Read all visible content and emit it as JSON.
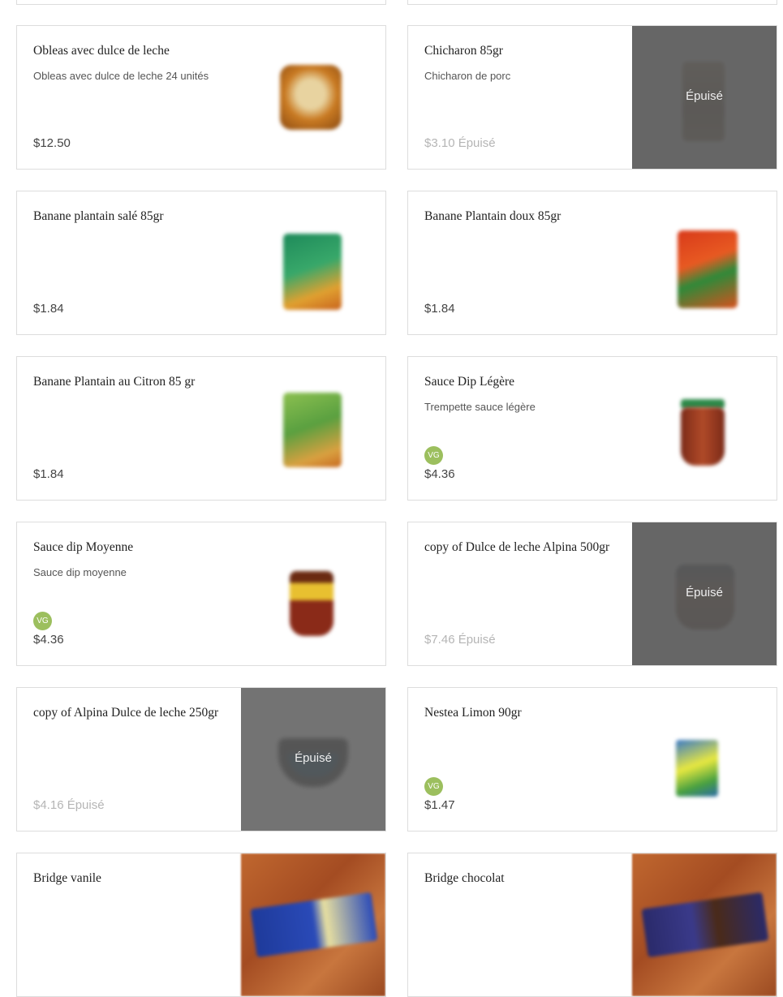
{
  "sold_out_label": "Épuisé",
  "vg_badge": "VG",
  "colors": {
    "border": "#dddddd",
    "overlay": "#5a5a5a",
    "vg_badge": "#9cbf5e",
    "sold_out_price": "#b5b5b5"
  },
  "products": [
    {
      "name": "Obleas avec dulce de leche",
      "description": "Obleas avec dulce de leche 24 unités",
      "price": "$12.50",
      "sold_out": false,
      "vegan": false,
      "image": "wafer-box-thumbnail"
    },
    {
      "name": "Chicharon 85gr",
      "description": "Chicharon de porc",
      "price": "$3.10 Épuisé",
      "sold_out": true,
      "vegan": false,
      "image": "chicharon-bag-thumbnail"
    },
    {
      "name": "Banane plantain salé 85gr",
      "description": "",
      "price": "$1.84",
      "sold_out": false,
      "vegan": false,
      "image": "green-chips-bag-thumbnail"
    },
    {
      "name": "Banane Plantain doux 85gr",
      "description": "",
      "price": "$1.84",
      "sold_out": false,
      "vegan": false,
      "image": "red-chips-bag-thumbnail"
    },
    {
      "name": "Banane Plantain au Citron 85 gr",
      "description": "",
      "price": "$1.84",
      "sold_out": false,
      "vegan": false,
      "image": "lime-chips-bag-thumbnail"
    },
    {
      "name": "Sauce Dip Légère",
      "description": "Trempette sauce légère",
      "price": "$4.36",
      "sold_out": false,
      "vegan": true,
      "image": "sauce-jar-green-lid-thumbnail"
    },
    {
      "name": "Sauce dip Moyenne",
      "description": "Sauce dip moyenne",
      "price": "$4.36",
      "sold_out": false,
      "vegan": true,
      "image": "sauce-jar-yellow-label-thumbnail"
    },
    {
      "name": "copy of Dulce de leche Alpina 500gr",
      "description": "",
      "price": "$7.46 Épuisé",
      "sold_out": true,
      "vegan": false,
      "image": "dulce-de-leche-tub-thumbnail"
    },
    {
      "name": "copy of Alpina Dulce de leche 250gr",
      "description": "",
      "price": "$4.16 Épuisé",
      "sold_out": true,
      "vegan": false,
      "image": "dulce-de-leche-small-tub-thumbnail"
    },
    {
      "name": "Nestea Limon 90gr",
      "description": "",
      "price": "$1.47",
      "sold_out": false,
      "vegan": true,
      "image": "nestea-pouch-thumbnail"
    },
    {
      "name": "Bridge vanile",
      "description": "",
      "price": "",
      "sold_out": false,
      "vegan": false,
      "image": "bridge-vanilla-package-thumbnail"
    },
    {
      "name": "Bridge chocolat",
      "description": "",
      "price": "",
      "sold_out": false,
      "vegan": false,
      "image": "bridge-chocolate-package-thumbnail"
    }
  ]
}
